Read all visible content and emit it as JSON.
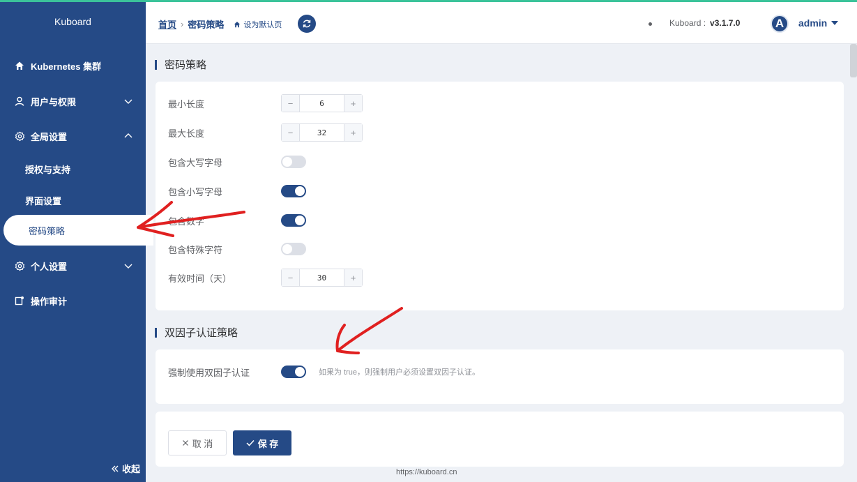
{
  "sidebar": {
    "brand": "Kuboard",
    "items": [
      {
        "label": "Kubernetes 集群",
        "icon": "home-icon"
      },
      {
        "label": "用户与权限",
        "icon": "user-icon"
      },
      {
        "label": "全局设置",
        "icon": "gear-icon"
      },
      {
        "label": "授权与支持"
      },
      {
        "label": "界面设置"
      },
      {
        "label": "密码策略"
      },
      {
        "label": "个人设置",
        "icon": "gear-icon"
      },
      {
        "label": "操作审计",
        "icon": "audit-icon"
      }
    ],
    "collapse_label": "收起"
  },
  "header": {
    "breadcrumb_home": "首页",
    "breadcrumb_current": "密码策略",
    "set_default": "设为默认页",
    "version_label": "Kuboard :",
    "version": "v3.1.7.0",
    "avatar_letter": "A",
    "username": "admin"
  },
  "password_policy": {
    "title": "密码策略",
    "min_length_label": "最小长度",
    "min_length": "6",
    "max_length_label": "最大长度",
    "max_length": "32",
    "uppercase_label": "包含大写字母",
    "uppercase": false,
    "lowercase_label": "包含小写字母",
    "lowercase": true,
    "digits_label": "包含数字",
    "digits": true,
    "special_label": "包含特殊字符",
    "special": false,
    "valid_days_label": "有效时间（天）",
    "valid_days": "30"
  },
  "two_factor": {
    "title": "双因子认证策略",
    "force_label": "强制使用双因子认证",
    "force": true,
    "hint": "如果为 true，则强制用户必须设置双因子认证。"
  },
  "actions": {
    "cancel": "取 消",
    "save": "保 存"
  },
  "footer": "https://kuboard.cn",
  "colors": {
    "primary": "#254a86",
    "accent": "#3bc39a",
    "annotation": "#e02020"
  }
}
